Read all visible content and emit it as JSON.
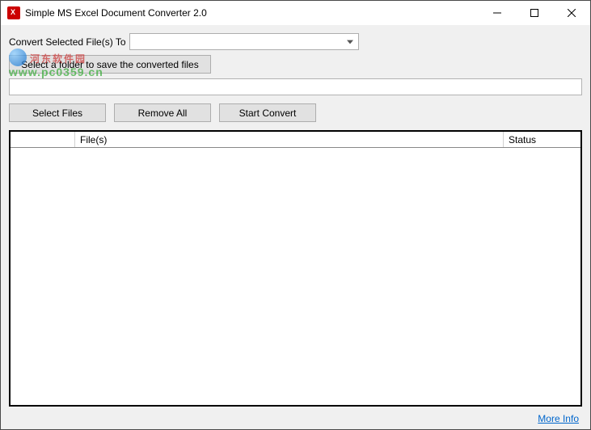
{
  "window": {
    "title": "Simple MS Excel Document Converter 2.0"
  },
  "watermark": {
    "line1": "河东软件园",
    "line2": "www.pc0359.cn"
  },
  "top": {
    "convert_label": "Convert Selected File(s) To",
    "select_folder_btn": "Select a folder to save the converted files",
    "path_value": ""
  },
  "buttons": {
    "select_files": "Select Files",
    "remove_all": "Remove All",
    "start_convert": "Start Convert"
  },
  "table": {
    "col_blank": "",
    "col_files": "File(s)",
    "col_status": "Status"
  },
  "footer": {
    "more_info": "More Info"
  }
}
